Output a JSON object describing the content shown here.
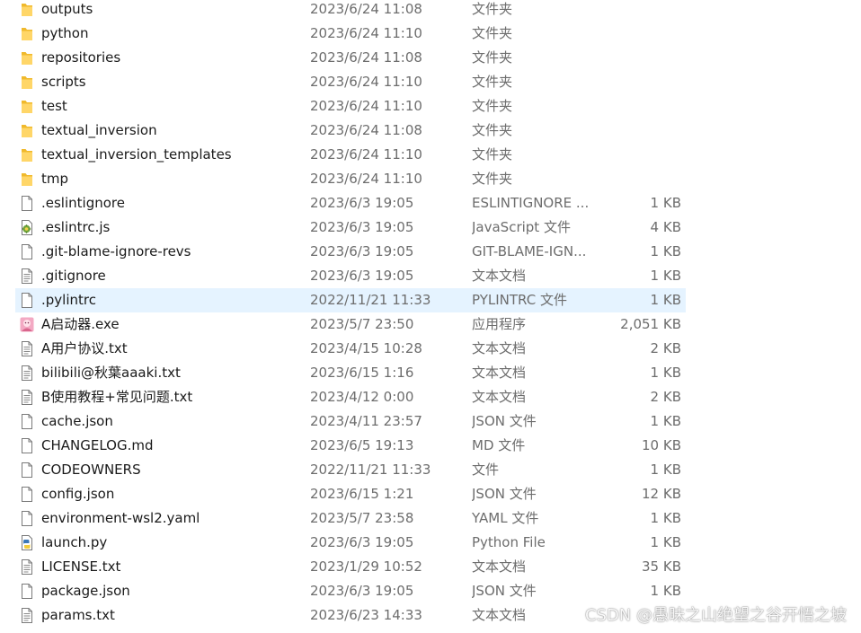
{
  "rows": [
    {
      "name": "outputs",
      "date": "2023/6/24 11:08",
      "type": "文件夹",
      "size": "",
      "icon": "folder-icon"
    },
    {
      "name": "python",
      "date": "2023/6/24 11:10",
      "type": "文件夹",
      "size": "",
      "icon": "folder-icon"
    },
    {
      "name": "repositories",
      "date": "2023/6/24 11:08",
      "type": "文件夹",
      "size": "",
      "icon": "folder-icon"
    },
    {
      "name": "scripts",
      "date": "2023/6/24 11:10",
      "type": "文件夹",
      "size": "",
      "icon": "folder-icon"
    },
    {
      "name": "test",
      "date": "2023/6/24 11:10",
      "type": "文件夹",
      "size": "",
      "icon": "folder-icon"
    },
    {
      "name": "textual_inversion",
      "date": "2023/6/24 11:08",
      "type": "文件夹",
      "size": "",
      "icon": "folder-icon"
    },
    {
      "name": "textual_inversion_templates",
      "date": "2023/6/24 11:10",
      "type": "文件夹",
      "size": "",
      "icon": "folder-icon"
    },
    {
      "name": "tmp",
      "date": "2023/6/24 11:10",
      "type": "文件夹",
      "size": "",
      "icon": "folder-icon"
    },
    {
      "name": ".eslintignore",
      "date": "2023/6/3 19:05",
      "type": "ESLINTIGNORE ...",
      "size": "1 KB",
      "icon": "blank-file-icon"
    },
    {
      "name": ".eslintrc.js",
      "date": "2023/6/3 19:05",
      "type": "JavaScript 文件",
      "size": "4 KB",
      "icon": "script-file-icon"
    },
    {
      "name": ".git-blame-ignore-revs",
      "date": "2023/6/3 19:05",
      "type": "GIT-BLAME-IGN...",
      "size": "1 KB",
      "icon": "blank-file-icon"
    },
    {
      "name": ".gitignore",
      "date": "2023/6/3 19:05",
      "type": "文本文档",
      "size": "1 KB",
      "icon": "text-file-icon"
    },
    {
      "name": ".pylintrc",
      "date": "2022/11/21 11:33",
      "type": "PYLINTRC 文件",
      "size": "1 KB",
      "icon": "blank-file-icon",
      "selected": true
    },
    {
      "name": "A启动器.exe",
      "date": "2023/5/7 23:50",
      "type": "应用程序",
      "size": "2,051 KB",
      "icon": "app-exe-icon"
    },
    {
      "name": "A用户协议.txt",
      "date": "2023/4/15 10:28",
      "type": "文本文档",
      "size": "2 KB",
      "icon": "text-file-icon"
    },
    {
      "name": "bilibili@秋葉aaaki.txt",
      "date": "2023/6/15 1:16",
      "type": "文本文档",
      "size": "1 KB",
      "icon": "text-file-icon"
    },
    {
      "name": "B使用教程+常见问题.txt",
      "date": "2023/4/12 0:00",
      "type": "文本文档",
      "size": "2 KB",
      "icon": "text-file-icon"
    },
    {
      "name": "cache.json",
      "date": "2023/4/11 23:57",
      "type": "JSON 文件",
      "size": "1 KB",
      "icon": "blank-file-icon"
    },
    {
      "name": "CHANGELOG.md",
      "date": "2023/6/5 19:13",
      "type": "MD 文件",
      "size": "10 KB",
      "icon": "blank-file-icon"
    },
    {
      "name": "CODEOWNERS",
      "date": "2022/11/21 11:33",
      "type": "文件",
      "size": "1 KB",
      "icon": "blank-file-icon"
    },
    {
      "name": "config.json",
      "date": "2023/6/15 1:21",
      "type": "JSON 文件",
      "size": "12 KB",
      "icon": "blank-file-icon"
    },
    {
      "name": "environment-wsl2.yaml",
      "date": "2023/5/7 23:58",
      "type": "YAML 文件",
      "size": "1 KB",
      "icon": "blank-file-icon"
    },
    {
      "name": "launch.py",
      "date": "2023/6/3 19:05",
      "type": "Python File",
      "size": "1 KB",
      "icon": "python-file-icon"
    },
    {
      "name": "LICENSE.txt",
      "date": "2023/1/29 10:52",
      "type": "文本文档",
      "size": "35 KB",
      "icon": "text-file-icon"
    },
    {
      "name": "package.json",
      "date": "2023/6/3 19:05",
      "type": "JSON 文件",
      "size": "1 KB",
      "icon": "blank-file-icon"
    },
    {
      "name": "params.txt",
      "date": "2023/6/23 14:33",
      "type": "文本文档",
      "size": "",
      "icon": "text-file-icon"
    }
  ],
  "watermark": "CSDN @愚昧之山绝望之谷开悟之坡",
  "colors": {
    "selection": "#e5f3ff",
    "folder": "#f5c542",
    "secondary_text": "#6d6d6d"
  }
}
